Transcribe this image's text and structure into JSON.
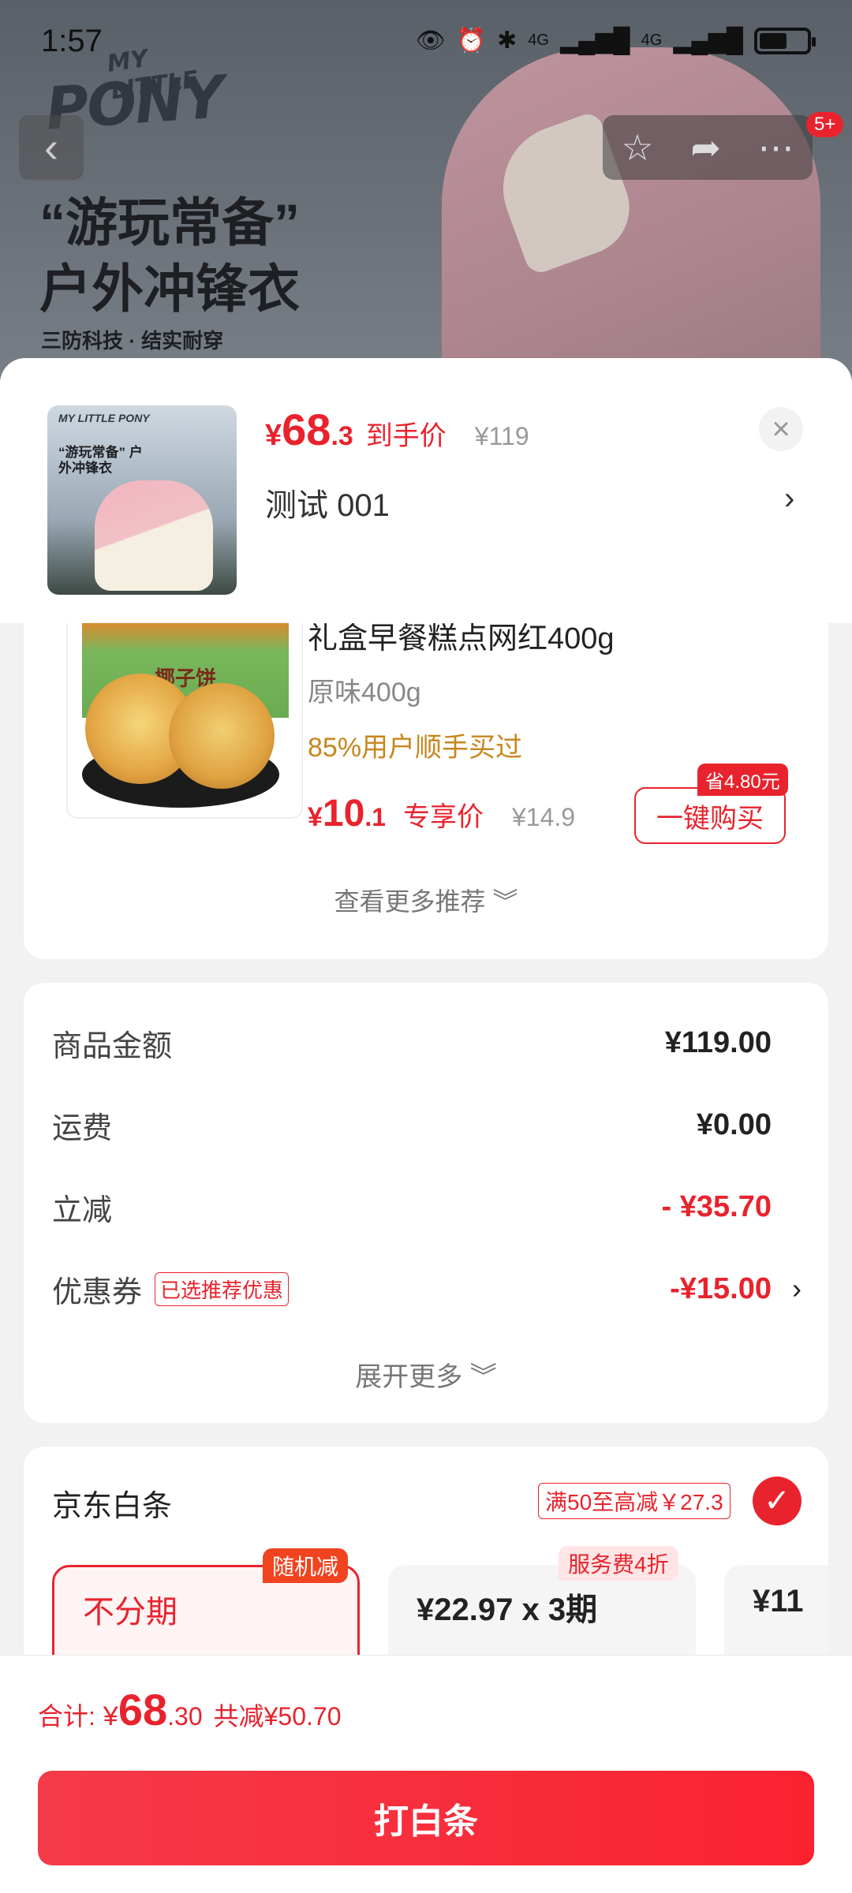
{
  "status_bar": {
    "time": "1:57",
    "network_1": "4G",
    "network_2": "4G"
  },
  "hero": {
    "logo_line1": "MY LITTLE",
    "logo_line2": "PONY",
    "headline_1": "“游玩常备”",
    "headline_2": "户外冲锋衣",
    "subline": "三防科技 · 结实耐穿"
  },
  "nav": {
    "back_icon": "chevron-left-icon",
    "favorite_icon": "star-icon",
    "share_icon": "share-icon",
    "more_icon": "more-icon",
    "notification_badge": "5+"
  },
  "product": {
    "thumb_logo": "MY LITTLE PONY",
    "thumb_title": "“游玩常备” 户外冲锋衣",
    "price_currency": "¥",
    "price_int": "68",
    "price_dec": ".3",
    "price_label": "到手价",
    "original_price": "¥119",
    "variant": "测试  001"
  },
  "recommendation": {
    "title": "礼盒早餐糕点网红400g",
    "box_label": "椰子饼",
    "spec": "原味400g",
    "social_proof": "85%用户顺手买过",
    "price_currency": "¥",
    "price_int": "10",
    "price_dec": ".1",
    "price_label": "专享价",
    "original_price": "¥14.9",
    "save_badge": "省4.80元",
    "buy_button": "一键购买",
    "more_link": "查看更多推荐 ︾"
  },
  "amount": {
    "rows": [
      {
        "label": "商品金额",
        "value": "¥119.00"
      },
      {
        "label": "运费",
        "value": "¥0.00"
      },
      {
        "label": "立减",
        "value": "- ¥35.70"
      },
      {
        "label": "优惠券",
        "value": "-¥15.00",
        "tag": "已选推荐优惠"
      }
    ],
    "expand_more": "展开更多 ︾"
  },
  "payment": {
    "title": "京东白条",
    "promo": "满50至高减￥27.3",
    "plans": [
      {
        "label": "不分期",
        "badge": "随机减"
      },
      {
        "label": "¥22.97 x 3期",
        "badge": "服务费4折"
      },
      {
        "label": "¥11"
      }
    ]
  },
  "bottom": {
    "total_label": "合计:",
    "total_currency": "¥",
    "total_int": "68",
    "total_dec": ".30",
    "total_save": "共减¥50.70",
    "pay_button": "打白条"
  },
  "colors": {
    "accent": "#e8232d",
    "orange_text": "#c7861d"
  }
}
